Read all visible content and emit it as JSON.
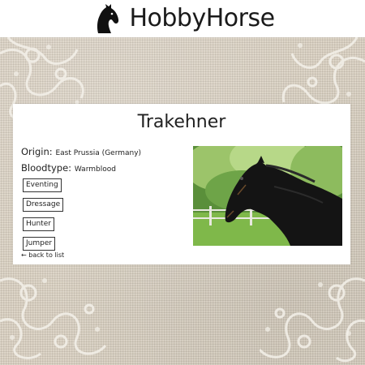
{
  "header": {
    "brand": "HobbyHorse",
    "logo_icon": "horse-head-icon"
  },
  "breed": {
    "name": "Trakehner",
    "origin_label": "Origin:",
    "origin_value": "East Prussia (Germany)",
    "bloodtype_label": "Bloodtype:",
    "bloodtype_value": "Warmblood",
    "disciplines": [
      "Eventing",
      "Dressage",
      "Hunter",
      "Jumper"
    ],
    "photo_icon": "horse-photo"
  },
  "nav": {
    "back_label": "← back to list"
  },
  "colors": {
    "background": "#d8cfc0",
    "card": "#ffffff",
    "text": "#222222",
    "lace": "#f4f1ea"
  }
}
